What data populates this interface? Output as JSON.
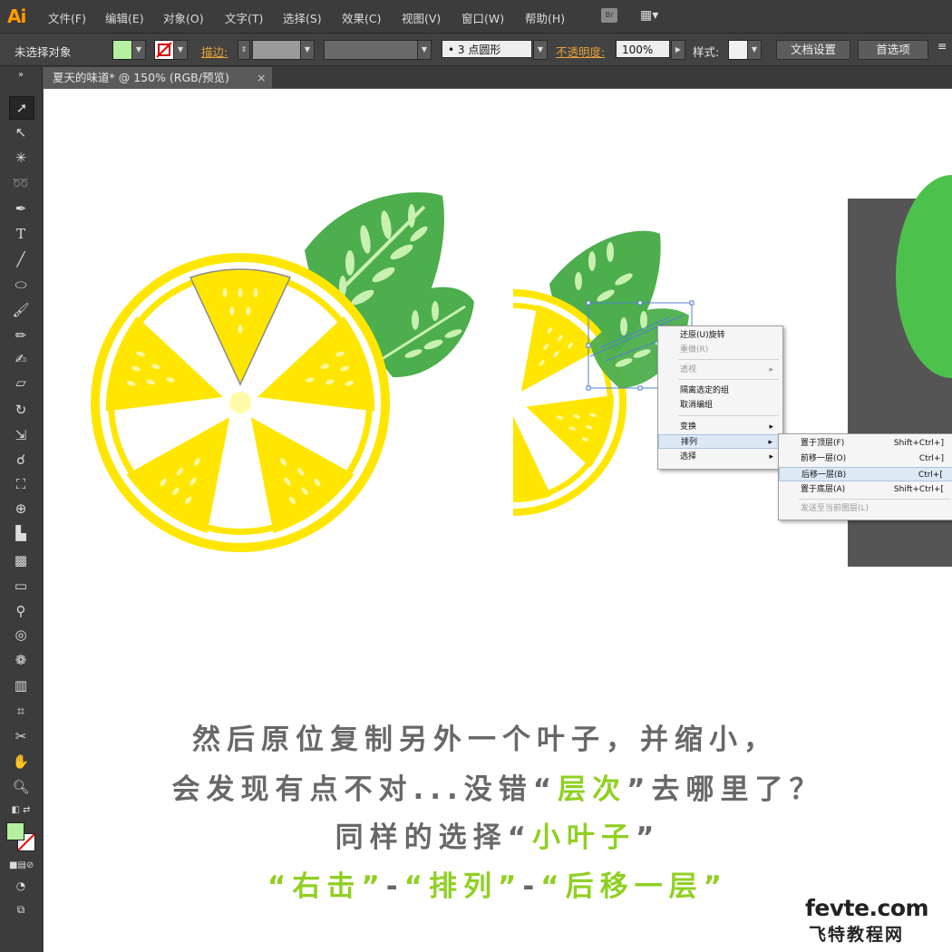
{
  "app": {
    "logo": "Ai"
  },
  "menu": [
    "文件(F)",
    "编辑(E)",
    "对象(O)",
    "文字(T)",
    "选择(S)",
    "效果(C)",
    "视图(V)",
    "窗口(W)",
    "帮助(H)"
  ],
  "bridge_label": "Br",
  "control": {
    "selection_status": "未选择对象",
    "stroke_label": "描边:",
    "brush_value": "3 点圆形",
    "opacity_label": "不透明度:",
    "opacity_value": "100%",
    "style_label": "样式:",
    "doc_setup": "文档设置",
    "preferences": "首选项",
    "fill_color": "#b4f0a0"
  },
  "tab": {
    "title": "夏天的味道* @ 150% (RGB/预览)",
    "close": "×"
  },
  "context_menu": {
    "items": [
      "还原(U)旋转",
      "重做(R)",
      "透视",
      "隔离选定的组",
      "取消编组",
      "变换",
      "排列",
      "选择"
    ],
    "submenu": [
      {
        "label": "置于顶层(F)",
        "shortcut": "Shift+Ctrl+]"
      },
      {
        "label": "前移一层(O)",
        "shortcut": "Ctrl+]"
      },
      {
        "label": "后移一层(B)",
        "shortcut": "Ctrl+["
      },
      {
        "label": "置于底层(A)",
        "shortcut": "Shift+Ctrl+["
      },
      {
        "label": "发送至当前图层(L)",
        "shortcut": ""
      }
    ]
  },
  "caption": {
    "line1": "然后原位复制另外一个叶子，并缩小，",
    "line2_a": "会发现有点不对...没错“",
    "line2_hl": "层次",
    "line2_b": "”去哪里了？",
    "line3_a": "同样的选择“",
    "line3_hl": "小叶子",
    "line3_b": "”",
    "line4_hl1": "“右击”",
    "line4_sep1": "-",
    "line4_hl2": "“排列”",
    "line4_sep2": "-",
    "line4_hl3": "“后移一层”"
  },
  "watermark": {
    "line1": "fevte.com",
    "line2": "飞特教程网"
  },
  "colors": {
    "lemon": "#ffe600",
    "leaf_dark": "#4cae4c",
    "leaf_light": "#c8f0b0",
    "accent": "#8fd022"
  }
}
